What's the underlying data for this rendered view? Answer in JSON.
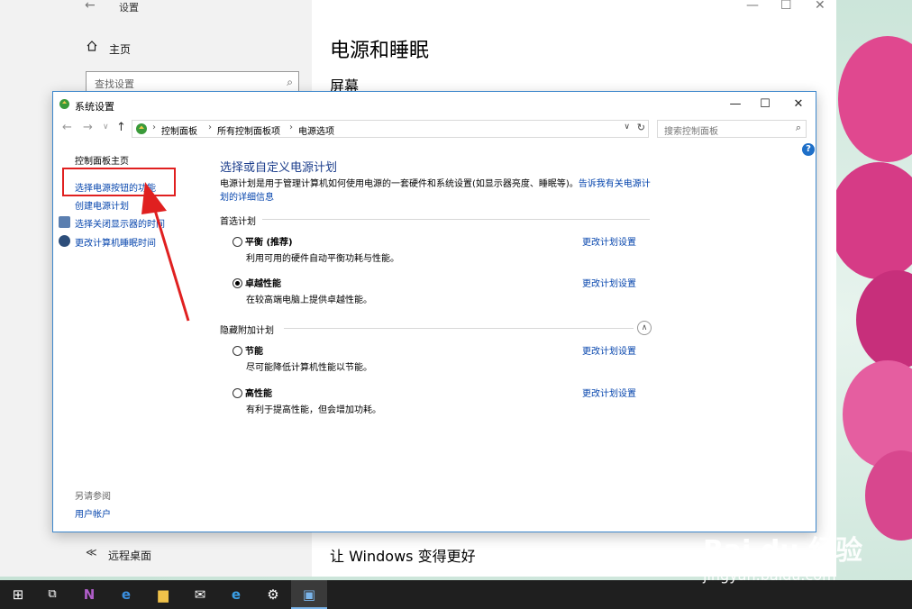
{
  "settings_window": {
    "title": "设置",
    "home_label": "主页",
    "search_placeholder": "查找设置",
    "remote_desktop_label": "远程桌面",
    "page_heading": "电源和睡眠",
    "section_screen": "屏幕",
    "bottom_heading": "让 Windows 变得更好"
  },
  "control_panel": {
    "title": "系统设置",
    "breadcrumb": [
      "控制面板",
      "所有控制面板项",
      "电源选项"
    ],
    "search_placeholder": "搜索控制面板",
    "sidebar": {
      "home": "控制面板主页",
      "items": [
        {
          "label": "选择电源按钮的功能",
          "icon": "none",
          "highlighted": true
        },
        {
          "label": "创建电源计划",
          "icon": "none"
        },
        {
          "label": "选择关闭显示器的时间",
          "icon": "monitor-icon"
        },
        {
          "label": "更改计算机睡眠时间",
          "icon": "moon-icon"
        }
      ],
      "see_also_header": "另请参阅",
      "see_also_items": [
        "用户帐户"
      ]
    },
    "main": {
      "title": "选择或自定义电源计划",
      "description": "电源计划是用于管理计算机如何使用电源的一套硬件和系统设置(如显示器亮度、睡眠等)。",
      "description_link": "告诉我有关电源计划的详细信息",
      "preferred_section": "首选计划",
      "hidden_section": "隐藏附加计划",
      "change_link": "更改计划设置",
      "preferred_plans": [
        {
          "name": "平衡 (推荐)",
          "desc": "利用可用的硬件自动平衡功耗与性能。",
          "selected": false
        },
        {
          "name": "卓越性能",
          "desc": "在较高端电脑上提供卓越性能。",
          "selected": true
        }
      ],
      "hidden_plans": [
        {
          "name": "节能",
          "desc": "尽可能降低计算机性能以节能。",
          "selected": false
        },
        {
          "name": "高性能",
          "desc": "有利于提高性能，但会增加功耗。",
          "selected": false
        }
      ]
    }
  },
  "taskbar": {
    "items": [
      "windows-start-icon",
      "task-view-icon",
      "onenote-icon",
      "edge-icon",
      "file-explorer-icon",
      "mail-icon",
      "ie-icon",
      "settings-icon",
      "control-panel-icon"
    ]
  },
  "watermark": {
    "text": "Bai du 经验",
    "url": "jingyan.baidu.com"
  },
  "colors": {
    "link": "#0645ad",
    "highlight": "#e02020",
    "accent": "#3d87cc"
  }
}
